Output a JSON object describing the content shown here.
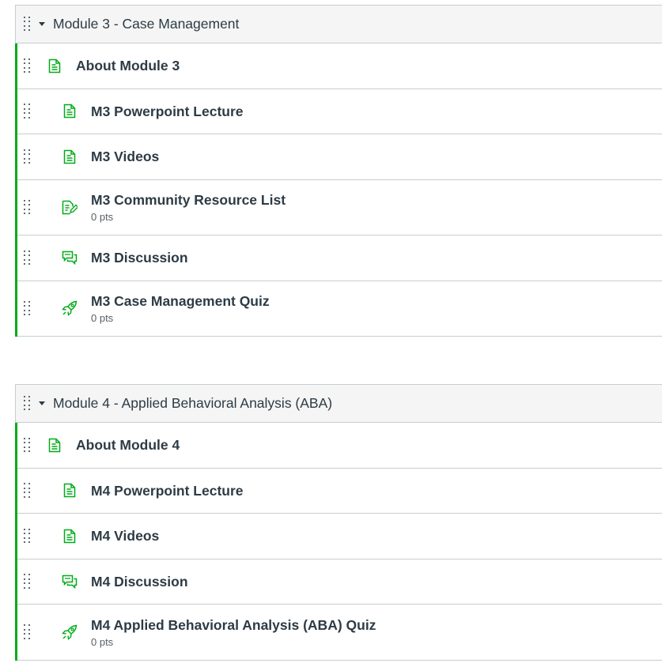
{
  "colors": {
    "accent_green": "#00ac18",
    "text": "#2d3b45",
    "meta_text": "#555f66",
    "border": "#c7cdd1",
    "header_bg": "#f5f5f5"
  },
  "modules": [
    {
      "title": "Module 3 - Case Management",
      "items": [
        {
          "title": "About Module 3",
          "icon": "page-icon",
          "meta": ""
        },
        {
          "title": "M3 Powerpoint Lecture",
          "icon": "page-icon",
          "meta": ""
        },
        {
          "title": "M3 Videos",
          "icon": "page-icon",
          "meta": ""
        },
        {
          "title": "M3 Community Resource List",
          "icon": "assignment-icon",
          "meta": "0 pts"
        },
        {
          "title": "M3 Discussion",
          "icon": "discussion-icon",
          "meta": ""
        },
        {
          "title": "M3 Case Management Quiz",
          "icon": "quiz-icon",
          "meta": "0 pts"
        }
      ]
    },
    {
      "title": "Module 4 - Applied Behavioral Analysis (ABA)",
      "items": [
        {
          "title": "About Module 4",
          "icon": "page-icon",
          "meta": ""
        },
        {
          "title": "M4 Powerpoint Lecture",
          "icon": "page-icon",
          "meta": ""
        },
        {
          "title": "M4 Videos",
          "icon": "page-icon",
          "meta": ""
        },
        {
          "title": "M4 Discussion",
          "icon": "discussion-icon",
          "meta": ""
        },
        {
          "title": "M4 Applied Behavioral Analysis (ABA) Quiz",
          "icon": "quiz-icon",
          "meta": "0 pts"
        }
      ]
    }
  ]
}
